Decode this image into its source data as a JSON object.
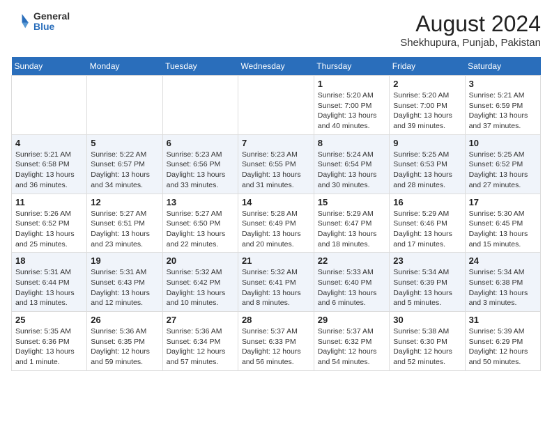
{
  "header": {
    "logo": {
      "general": "General",
      "blue": "Blue"
    },
    "title": "August 2024",
    "subtitle": "Shekhupura, Punjab, Pakistan"
  },
  "days_of_week": [
    "Sunday",
    "Monday",
    "Tuesday",
    "Wednesday",
    "Thursday",
    "Friday",
    "Saturday"
  ],
  "weeks": [
    [
      {
        "day": "",
        "info": ""
      },
      {
        "day": "",
        "info": ""
      },
      {
        "day": "",
        "info": ""
      },
      {
        "day": "",
        "info": ""
      },
      {
        "day": "1",
        "info": "Sunrise: 5:20 AM\nSunset: 7:00 PM\nDaylight: 13 hours\nand 40 minutes."
      },
      {
        "day": "2",
        "info": "Sunrise: 5:20 AM\nSunset: 7:00 PM\nDaylight: 13 hours\nand 39 minutes."
      },
      {
        "day": "3",
        "info": "Sunrise: 5:21 AM\nSunset: 6:59 PM\nDaylight: 13 hours\nand 37 minutes."
      }
    ],
    [
      {
        "day": "4",
        "info": "Sunrise: 5:21 AM\nSunset: 6:58 PM\nDaylight: 13 hours\nand 36 minutes."
      },
      {
        "day": "5",
        "info": "Sunrise: 5:22 AM\nSunset: 6:57 PM\nDaylight: 13 hours\nand 34 minutes."
      },
      {
        "day": "6",
        "info": "Sunrise: 5:23 AM\nSunset: 6:56 PM\nDaylight: 13 hours\nand 33 minutes."
      },
      {
        "day": "7",
        "info": "Sunrise: 5:23 AM\nSunset: 6:55 PM\nDaylight: 13 hours\nand 31 minutes."
      },
      {
        "day": "8",
        "info": "Sunrise: 5:24 AM\nSunset: 6:54 PM\nDaylight: 13 hours\nand 30 minutes."
      },
      {
        "day": "9",
        "info": "Sunrise: 5:25 AM\nSunset: 6:53 PM\nDaylight: 13 hours\nand 28 minutes."
      },
      {
        "day": "10",
        "info": "Sunrise: 5:25 AM\nSunset: 6:52 PM\nDaylight: 13 hours\nand 27 minutes."
      }
    ],
    [
      {
        "day": "11",
        "info": "Sunrise: 5:26 AM\nSunset: 6:52 PM\nDaylight: 13 hours\nand 25 minutes."
      },
      {
        "day": "12",
        "info": "Sunrise: 5:27 AM\nSunset: 6:51 PM\nDaylight: 13 hours\nand 23 minutes."
      },
      {
        "day": "13",
        "info": "Sunrise: 5:27 AM\nSunset: 6:50 PM\nDaylight: 13 hours\nand 22 minutes."
      },
      {
        "day": "14",
        "info": "Sunrise: 5:28 AM\nSunset: 6:49 PM\nDaylight: 13 hours\nand 20 minutes."
      },
      {
        "day": "15",
        "info": "Sunrise: 5:29 AM\nSunset: 6:47 PM\nDaylight: 13 hours\nand 18 minutes."
      },
      {
        "day": "16",
        "info": "Sunrise: 5:29 AM\nSunset: 6:46 PM\nDaylight: 13 hours\nand 17 minutes."
      },
      {
        "day": "17",
        "info": "Sunrise: 5:30 AM\nSunset: 6:45 PM\nDaylight: 13 hours\nand 15 minutes."
      }
    ],
    [
      {
        "day": "18",
        "info": "Sunrise: 5:31 AM\nSunset: 6:44 PM\nDaylight: 13 hours\nand 13 minutes."
      },
      {
        "day": "19",
        "info": "Sunrise: 5:31 AM\nSunset: 6:43 PM\nDaylight: 13 hours\nand 12 minutes."
      },
      {
        "day": "20",
        "info": "Sunrise: 5:32 AM\nSunset: 6:42 PM\nDaylight: 13 hours\nand 10 minutes."
      },
      {
        "day": "21",
        "info": "Sunrise: 5:32 AM\nSunset: 6:41 PM\nDaylight: 13 hours\nand 8 minutes."
      },
      {
        "day": "22",
        "info": "Sunrise: 5:33 AM\nSunset: 6:40 PM\nDaylight: 13 hours\nand 6 minutes."
      },
      {
        "day": "23",
        "info": "Sunrise: 5:34 AM\nSunset: 6:39 PM\nDaylight: 13 hours\nand 5 minutes."
      },
      {
        "day": "24",
        "info": "Sunrise: 5:34 AM\nSunset: 6:38 PM\nDaylight: 13 hours\nand 3 minutes."
      }
    ],
    [
      {
        "day": "25",
        "info": "Sunrise: 5:35 AM\nSunset: 6:36 PM\nDaylight: 13 hours\nand 1 minute."
      },
      {
        "day": "26",
        "info": "Sunrise: 5:36 AM\nSunset: 6:35 PM\nDaylight: 12 hours\nand 59 minutes."
      },
      {
        "day": "27",
        "info": "Sunrise: 5:36 AM\nSunset: 6:34 PM\nDaylight: 12 hours\nand 57 minutes."
      },
      {
        "day": "28",
        "info": "Sunrise: 5:37 AM\nSunset: 6:33 PM\nDaylight: 12 hours\nand 56 minutes."
      },
      {
        "day": "29",
        "info": "Sunrise: 5:37 AM\nSunset: 6:32 PM\nDaylight: 12 hours\nand 54 minutes."
      },
      {
        "day": "30",
        "info": "Sunrise: 5:38 AM\nSunset: 6:30 PM\nDaylight: 12 hours\nand 52 minutes."
      },
      {
        "day": "31",
        "info": "Sunrise: 5:39 AM\nSunset: 6:29 PM\nDaylight: 12 hours\nand 50 minutes."
      }
    ]
  ]
}
